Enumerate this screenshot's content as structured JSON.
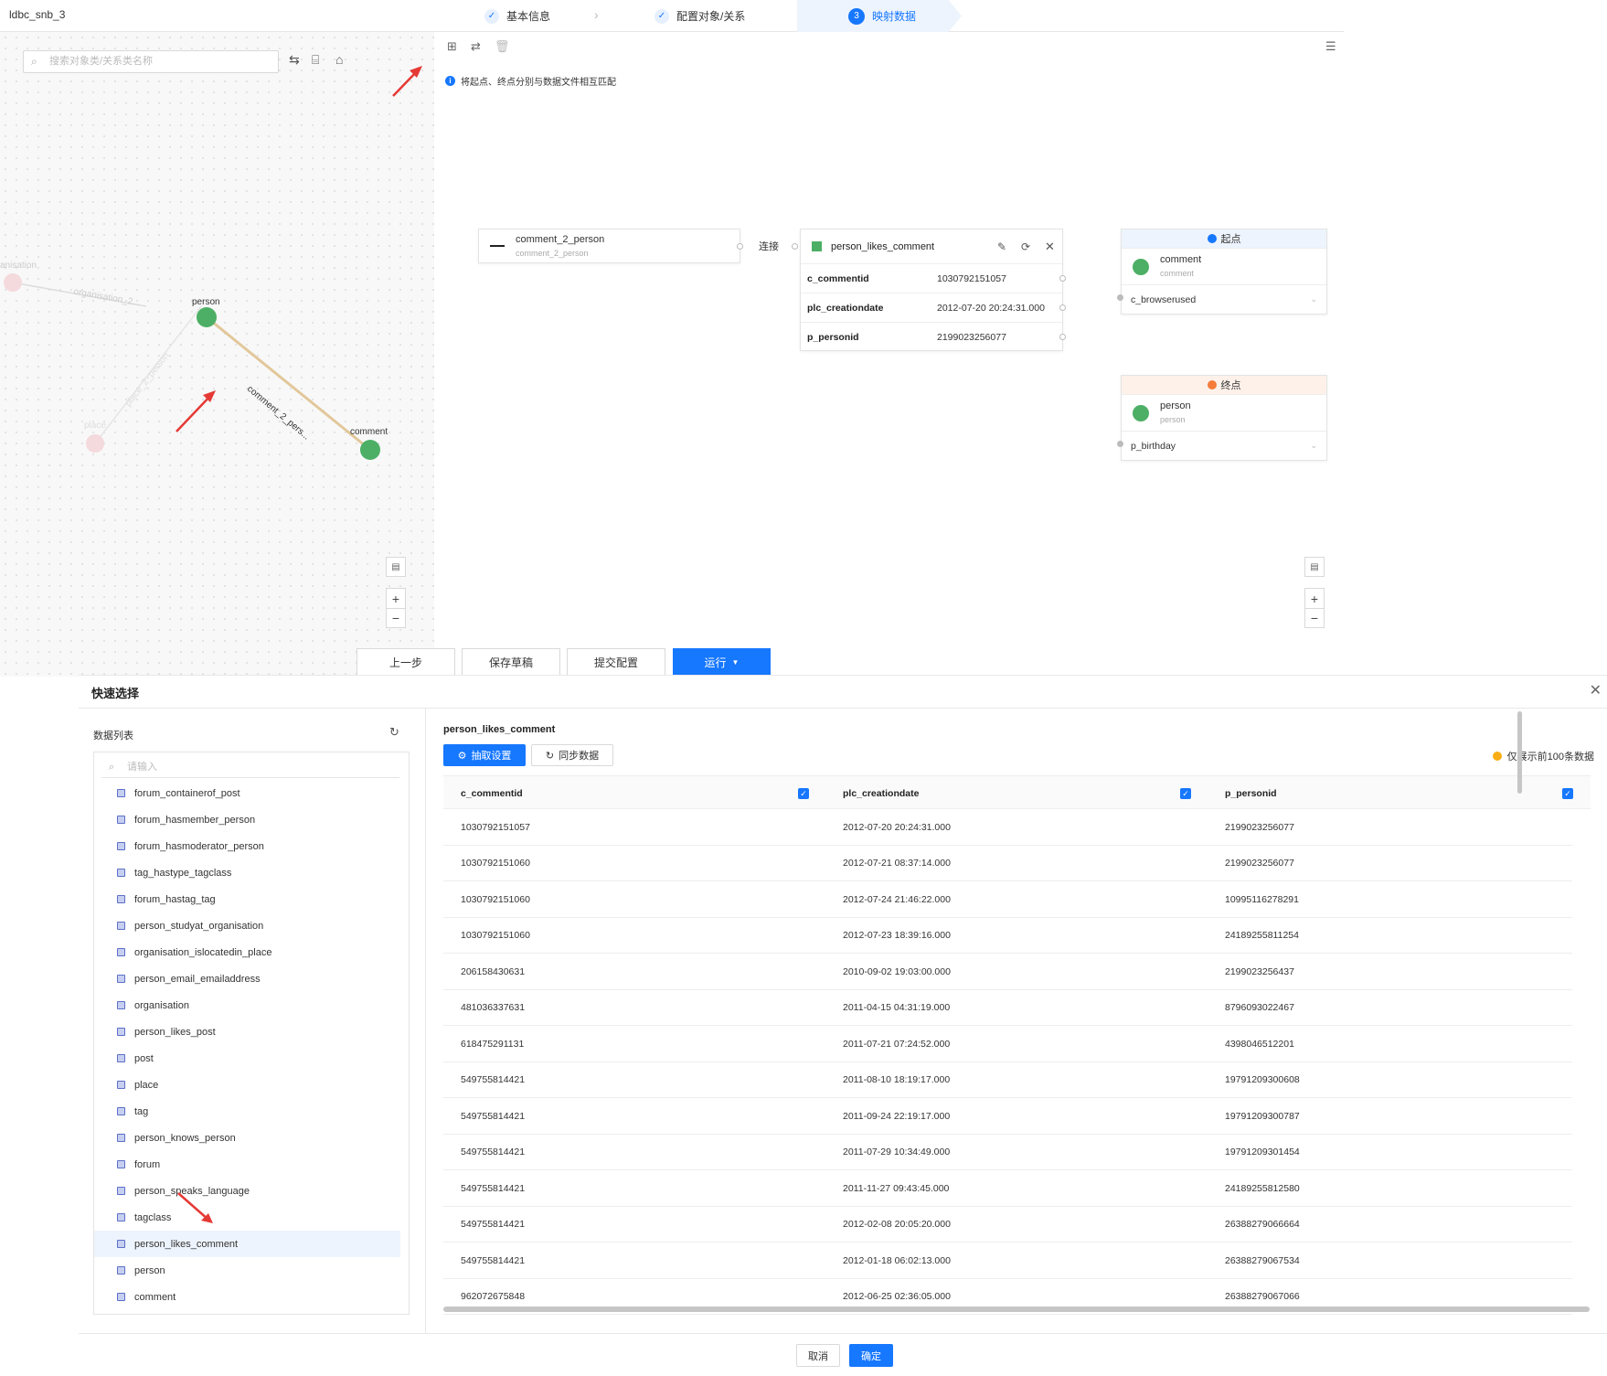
{
  "header": {
    "project": "ldbc_snb_3",
    "steps": [
      {
        "label": "基本信息",
        "state": "done"
      },
      {
        "label": "配置对象/关系",
        "state": "done"
      },
      {
        "label": "映射数据",
        "state": "active",
        "number": "3"
      }
    ]
  },
  "left_canvas": {
    "search_placeholder": "搜索对象类/关系类名称",
    "nodes": {
      "person": "person",
      "comment": "comment",
      "place": "place",
      "organisation": "anisation"
    },
    "edges": {
      "main": "comment_2_pers...",
      "faded1": "organisation_2...",
      "faded2": "place_2_person"
    },
    "zoom_in": "+",
    "zoom_out": "−"
  },
  "mapping": {
    "hint": "将起点、终点分别与数据文件相互匹配",
    "relation": {
      "name": "comment_2_person",
      "sub": "comment_2_person"
    },
    "connect_label": "连接",
    "table": {
      "name": "person_likes_comment",
      "fields": [
        {
          "name": "c_commentid",
          "value": "1030792151057"
        },
        {
          "name": "plc_creationdate",
          "value": "2012-07-20 20:24:31.000"
        },
        {
          "name": "p_personid",
          "value": "2199023256077"
        }
      ]
    },
    "start": {
      "badge": "起点",
      "name": "comment",
      "sub": "comment",
      "field": "c_browserused",
      "color": "#eef4fd"
    },
    "end": {
      "badge": "终点",
      "name": "person",
      "sub": "person",
      "field": "p_birthday",
      "color": "#fdf1ea"
    },
    "zoom_in": "+",
    "zoom_out": "−"
  },
  "actions": {
    "prev": "上一步",
    "draft": "保存草稿",
    "submit": "提交配置",
    "run": "运行"
  },
  "modal": {
    "title": "快速选择",
    "list_title": "数据列表",
    "search_placeholder": "请输入",
    "items": [
      "forum_containerof_post",
      "forum_hasmember_person",
      "forum_hasmoderator_person",
      "tag_hastype_tagclass",
      "forum_hastag_tag",
      "person_studyat_organisation",
      "organisation_islocatedin_place",
      "person_email_emailaddress",
      "organisation",
      "person_likes_post",
      "post",
      "place",
      "tag",
      "person_knows_person",
      "forum",
      "person_speaks_language",
      "tagclass",
      "person_likes_comment",
      "person",
      "comment"
    ],
    "selected": "person_likes_comment",
    "table_name": "person_likes_comment",
    "extract_btn": "抽取设置",
    "sync_btn": "同步数据",
    "notice": "仅展示前100条数据",
    "columns": [
      "c_commentid",
      "plc_creationdate",
      "p_personid"
    ],
    "rows": [
      [
        "1030792151057",
        "2012-07-20 20:24:31.000",
        "2199023256077"
      ],
      [
        "1030792151060",
        "2012-07-21 08:37:14.000",
        "2199023256077"
      ],
      [
        "1030792151060",
        "2012-07-24 21:46:22.000",
        "10995116278291"
      ],
      [
        "1030792151060",
        "2012-07-23 18:39:16.000",
        "24189255811254"
      ],
      [
        "206158430631",
        "2010-09-02 19:03:00.000",
        "2199023256437"
      ],
      [
        "481036337631",
        "2011-04-15 04:31:19.000",
        "8796093022467"
      ],
      [
        "618475291131",
        "2011-07-21 07:24:52.000",
        "4398046512201"
      ],
      [
        "549755814421",
        "2011-08-10 18:19:17.000",
        "19791209300608"
      ],
      [
        "549755814421",
        "2011-09-24 22:19:17.000",
        "19791209300787"
      ],
      [
        "549755814421",
        "2011-07-29 10:34:49.000",
        "19791209301454"
      ],
      [
        "549755814421",
        "2011-11-27 09:43:45.000",
        "24189255812580"
      ],
      [
        "549755814421",
        "2012-02-08 20:05:20.000",
        "26388279066664"
      ],
      [
        "549755814421",
        "2012-01-18 06:02:13.000",
        "26388279067534"
      ],
      [
        "962072675848",
        "2012-06-25 02:36:05.000",
        "26388279067066"
      ]
    ],
    "cancel": "取消",
    "ok": "确定"
  }
}
